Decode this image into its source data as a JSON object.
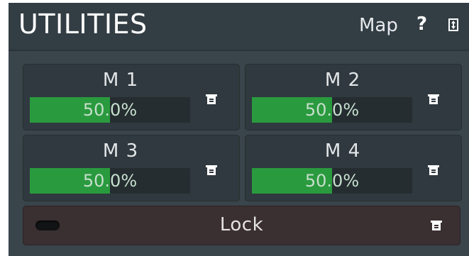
{
  "header": {
    "title": "UTILITIES",
    "map_label": "Map",
    "help_label": "?"
  },
  "macros": [
    {
      "label": "M 1",
      "value_text": "50.0%",
      "value": 0.5
    },
    {
      "label": "M 2",
      "value_text": "50.0%",
      "value": 0.5
    },
    {
      "label": "M 3",
      "value_text": "50.0%",
      "value": 0.5
    },
    {
      "label": "M 4",
      "value_text": "50.0%",
      "value": 0.5
    }
  ],
  "lock": {
    "label": "Lock",
    "enabled": false
  },
  "icons": {
    "help": "help-icon",
    "resize": "resize-icon",
    "menu": "menu-icon",
    "toggle": "toggle-led-icon"
  },
  "colors": {
    "accent_green": "#2a9a3e",
    "panel_bg": "#39444b",
    "lock_bg": "#3a2f31"
  }
}
